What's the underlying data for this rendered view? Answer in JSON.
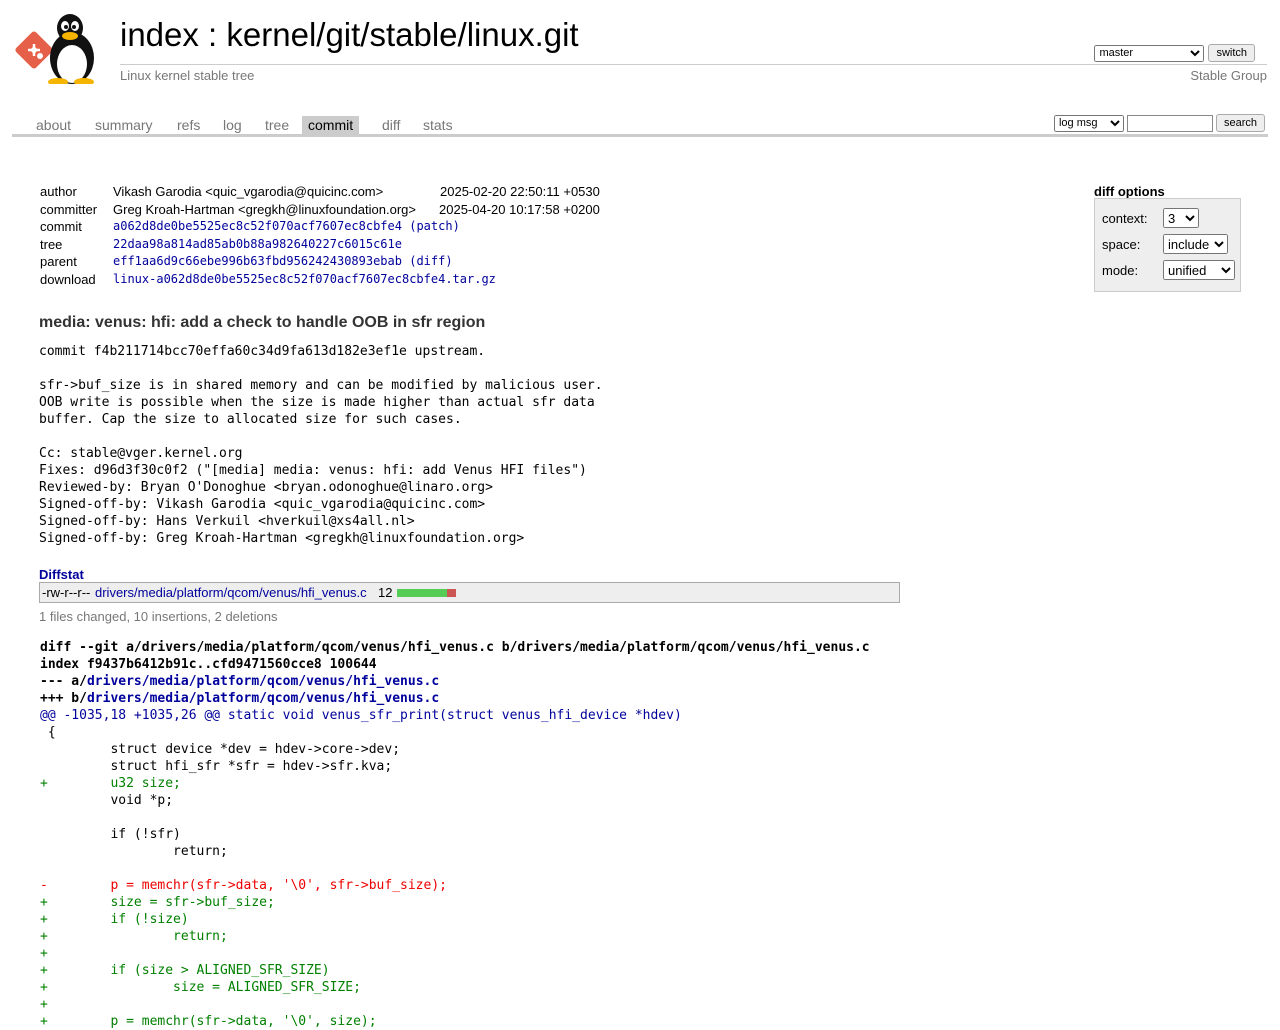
{
  "header": {
    "title_index": "index",
    "title_sep": " : ",
    "title_repo": "kernel/git/stable/linux.git",
    "subtitle": "Linux kernel stable tree",
    "owner": "Stable Group",
    "branch_selected": "master",
    "switch_label": "switch"
  },
  "tabs": [
    "about",
    "summary",
    "refs",
    "log",
    "tree",
    "commit",
    "diff",
    "stats"
  ],
  "active_tab": "commit",
  "search": {
    "mode_selected": "log msg",
    "query": "",
    "button_label": "search"
  },
  "commit_info": {
    "author_label": "author",
    "author": "Vikash Garodia <quic_vgarodia@quicinc.com>",
    "author_date": "2025-02-20 22:50:11 +0530",
    "committer_label": "committer",
    "committer": "Greg Kroah-Hartman <gregkh@linuxfoundation.org>",
    "committer_date": "2025-04-20 10:17:58 +0200",
    "commit_label": "commit",
    "commit": "a062d8de0be5525ec8c52f070acf7607ec8cbfe4",
    "commit_extra": "(patch)",
    "tree_label": "tree",
    "tree": "22daa98a814ad85ab0b88a982640227c6015c61e",
    "parent_label": "parent",
    "parent": "eff1aa6d9c66ebe996b63fbd956242430893ebab",
    "parent_extra": "(diff)",
    "download_label": "download",
    "download": "linux-a062d8de0be5525ec8c52f070acf7607ec8cbfe4.tar.gz"
  },
  "diff_options": {
    "title": "diff options",
    "context_label": "context:",
    "context_value": "3",
    "space_label": "space:",
    "space_value": "include",
    "mode_label": "mode:",
    "mode_value": "unified"
  },
  "commit_subject": "media: venus: hfi: add a check to handle OOB in sfr region",
  "commit_message": "commit f4b211714bcc70effa60c34d9fa613d182e3ef1e upstream.\n\nsfr->buf_size is in shared memory and can be modified by malicious user.\nOOB write is possible when the size is made higher than actual sfr data\nbuffer. Cap the size to allocated size for such cases.\n\nCc: stable@vger.kernel.org\nFixes: d96d3f30c0f2 (\"[media] media: venus: hfi: add Venus HFI files\")\nReviewed-by: Bryan O'Donoghue <bryan.odonoghue@linaro.org>\nSigned-off-by: Vikash Garodia <quic_vgarodia@quicinc.com>\nSigned-off-by: Hans Verkuil <hverkuil@xs4all.nl>\nSigned-off-by: Greg Kroah-Hartman <gregkh@linuxfoundation.org>",
  "diffstat": {
    "title": "Diffstat",
    "mode": "-rw-r--r--",
    "file": "drivers/media/platform/qcom/venus/hfi_venus.c",
    "count": "12",
    "insertions": 10,
    "deletions": 2,
    "summary": "1 files changed, 10 insertions, 2 deletions"
  },
  "diff": {
    "git_line": "diff --git a/drivers/media/platform/qcom/venus/hfi_venus.c b/drivers/media/platform/qcom/venus/hfi_venus.c",
    "index_line": "index f9437b6412b91c..cfd9471560cce8 100644",
    "minus_prefix": "--- a/",
    "plus_prefix": "+++ b/",
    "file_path": "drivers/media/platform/qcom/venus/hfi_venus.c",
    "hunk": "@@ -1035,18 +1035,26 @@ static void venus_sfr_print(struct venus_hfi_device *hdev)",
    "lines": [
      {
        "type": "ctx",
        "text": " {"
      },
      {
        "type": "ctx",
        "text": " \tstruct device *dev = hdev->core->dev;"
      },
      {
        "type": "ctx",
        "text": " \tstruct hfi_sfr *sfr = hdev->sfr.kva;"
      },
      {
        "type": "add",
        "text": "+\tu32 size;"
      },
      {
        "type": "ctx",
        "text": " \tvoid *p;"
      },
      {
        "type": "ctx",
        "text": " "
      },
      {
        "type": "ctx",
        "text": " \tif (!sfr)"
      },
      {
        "type": "ctx",
        "text": " \t\treturn;"
      },
      {
        "type": "ctx",
        "text": " "
      },
      {
        "type": "del",
        "text": "-\tp = memchr(sfr->data, '\\0', sfr->buf_size);"
      },
      {
        "type": "add",
        "text": "+\tsize = sfr->buf_size;"
      },
      {
        "type": "add",
        "text": "+\tif (!size)"
      },
      {
        "type": "add",
        "text": "+\t\treturn;"
      },
      {
        "type": "add",
        "text": "+"
      },
      {
        "type": "add",
        "text": "+\tif (size > ALIGNED_SFR_SIZE)"
      },
      {
        "type": "add",
        "text": "+\t\tsize = ALIGNED_SFR_SIZE;"
      },
      {
        "type": "add",
        "text": "+"
      },
      {
        "type": "add",
        "text": "+\tp = memchr(sfr->data, '\\0', size);"
      }
    ]
  }
}
